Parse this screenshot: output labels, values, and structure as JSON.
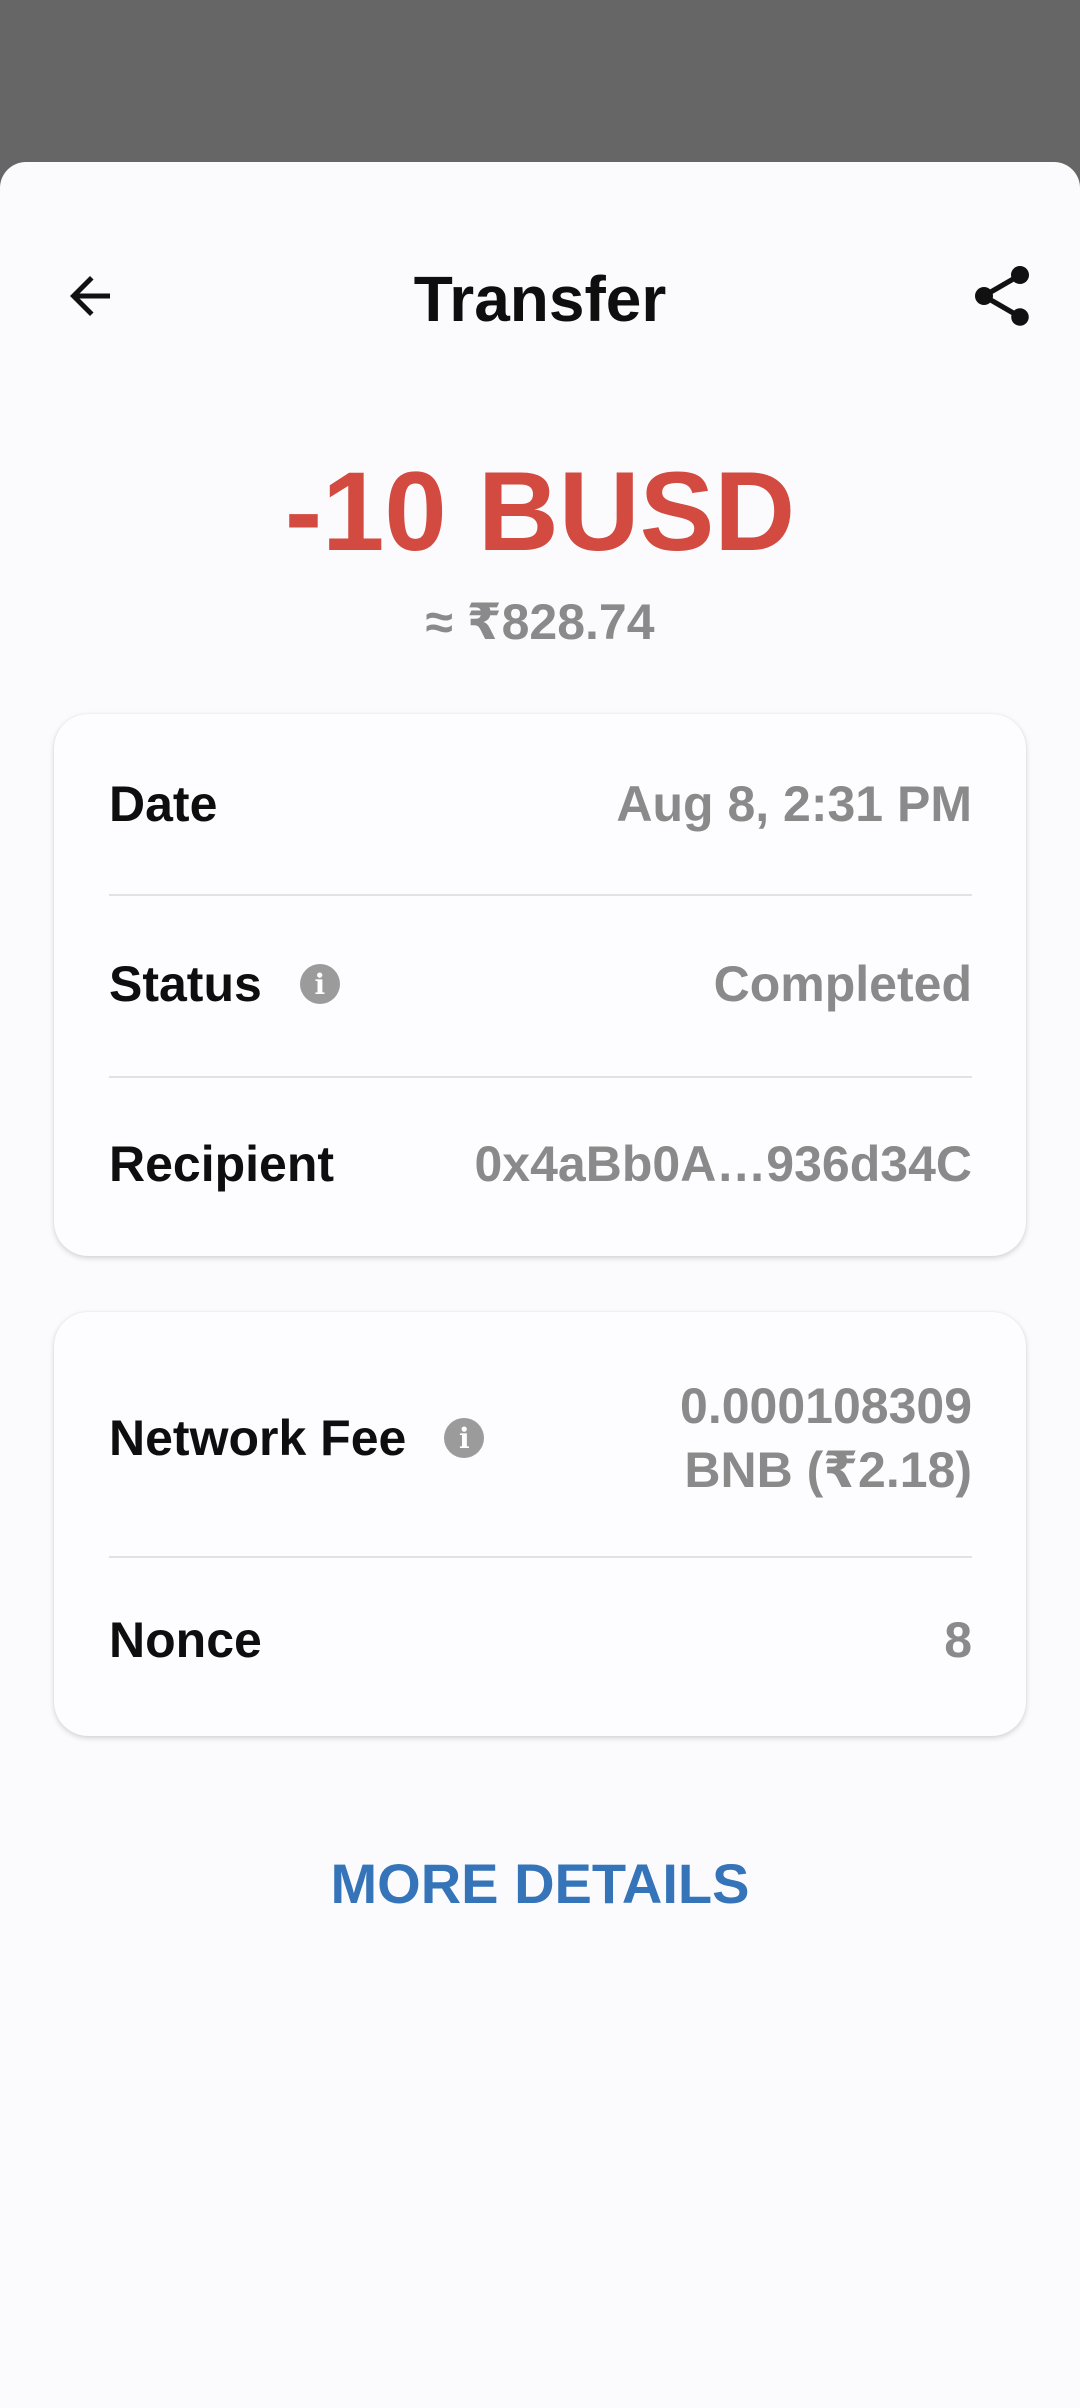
{
  "header": {
    "title": "Transfer",
    "back_icon": "arrow-left-icon",
    "share_icon": "share-icon"
  },
  "summary": {
    "amount": "-10 BUSD",
    "fiat": "≈ ₹828.74",
    "amount_color": "#d24a40"
  },
  "details": {
    "date_label": "Date",
    "date_value": "Aug 8, 2:31 PM",
    "status_label": "Status",
    "status_value": "Completed",
    "recipient_label": "Recipient",
    "recipient_value": "0x4aBb0A…936d34C"
  },
  "fees": {
    "network_fee_label": "Network Fee",
    "network_fee_value_line1": "0.000108309",
    "network_fee_value_line2": "BNB (₹2.18)",
    "nonce_label": "Nonce",
    "nonce_value": "8"
  },
  "actions": {
    "more_details": "MORE DETAILS",
    "link_color": "#3574b8"
  }
}
